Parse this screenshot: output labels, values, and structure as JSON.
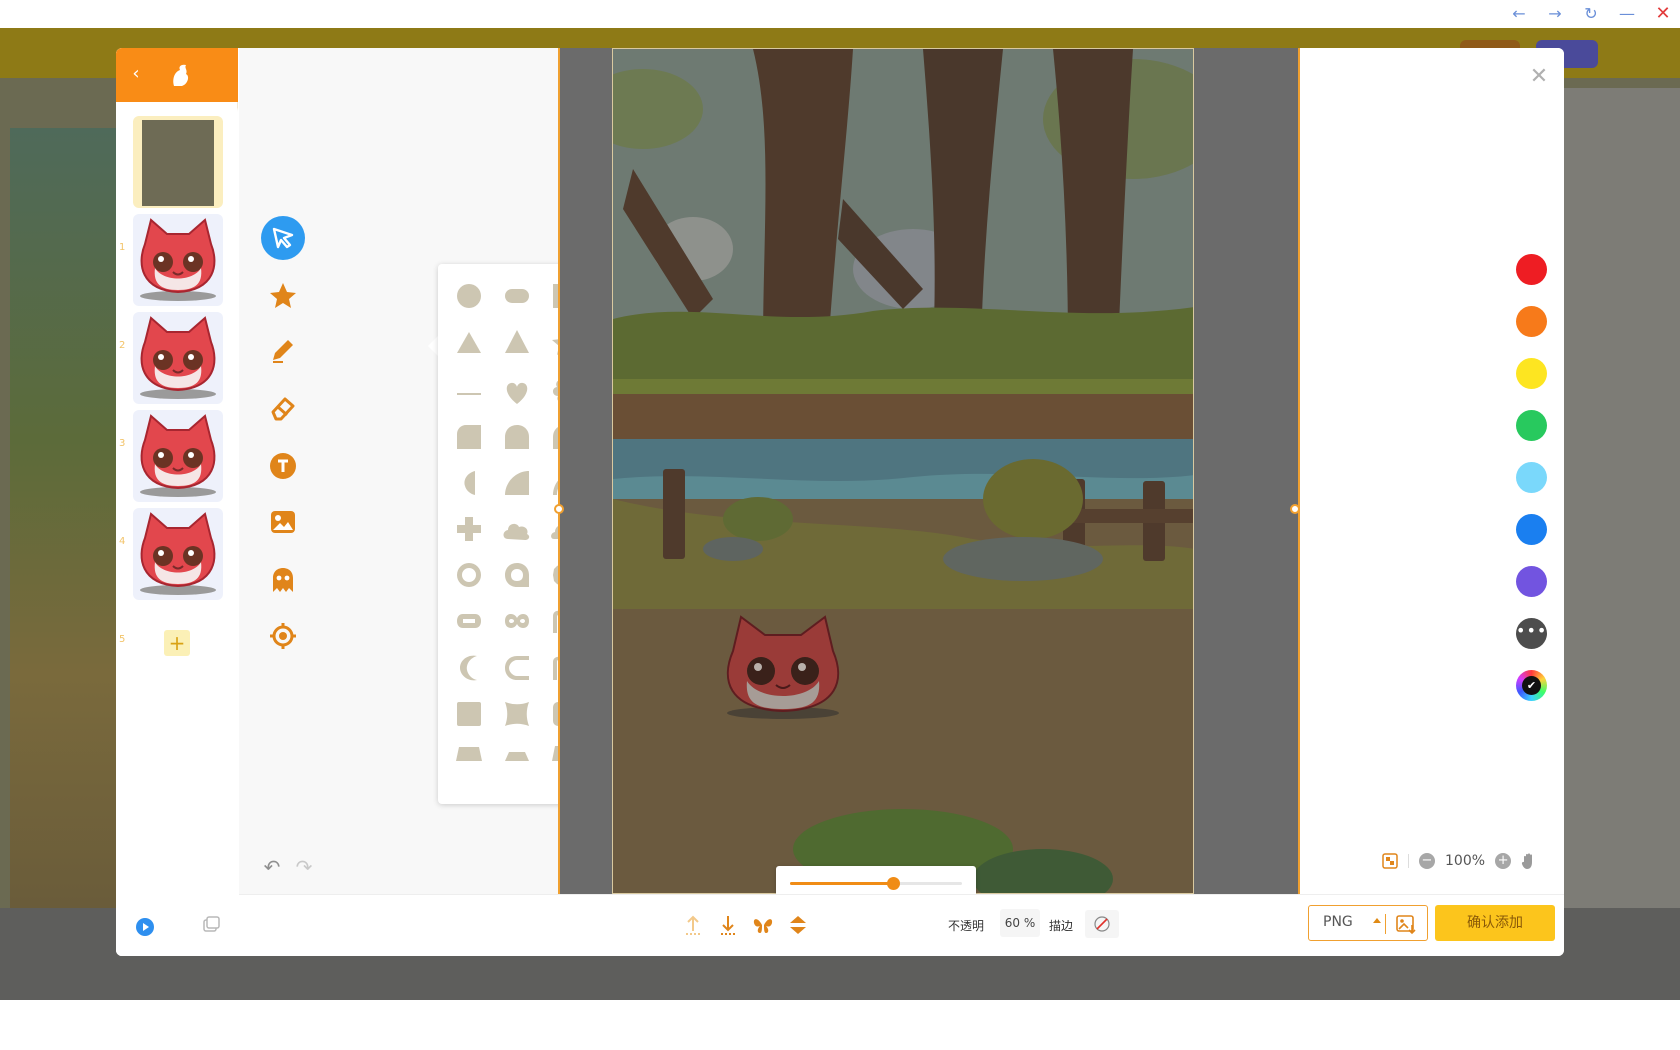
{
  "browser": {
    "back": "←",
    "forward": "→",
    "reload": "↻",
    "minimize": "—",
    "close": "✕"
  },
  "frames": {
    "items": [
      {
        "number": "1",
        "selected": true
      },
      {
        "number": "2",
        "selected": false
      },
      {
        "number": "3",
        "selected": false
      },
      {
        "number": "4",
        "selected": false
      },
      {
        "number": "5",
        "selected": false
      }
    ],
    "add_label": "+"
  },
  "tools": [
    "select-icon",
    "star-icon",
    "pencil-icon",
    "eraser-icon",
    "text-icon",
    "image-icon",
    "ghost-icon",
    "target-icon"
  ],
  "history": {
    "undo": "↶",
    "redo": "↷"
  },
  "colors": {
    "accent": "#f98c16",
    "select_blue": "#2e9bf0",
    "confirm": "#fcc51c",
    "shape_fill": "#cdc6b2",
    "swatches": [
      "#ee1d23",
      "#f77a1a",
      "#fde521",
      "#28c95e",
      "#7ad8fb",
      "#1a7ff0",
      "#7254e0"
    ]
  },
  "swatch_more": "•••",
  "zoom": {
    "minus": "−",
    "value": "100%",
    "plus": "+"
  },
  "bottombar": {
    "opacity_label": "不透明",
    "opacity_value": "60 %",
    "opacity_level": 0.6,
    "stroke_label": "描边"
  },
  "export": {
    "format": "PNG",
    "confirm_label": "确认添加"
  },
  "close_label": "✕"
}
